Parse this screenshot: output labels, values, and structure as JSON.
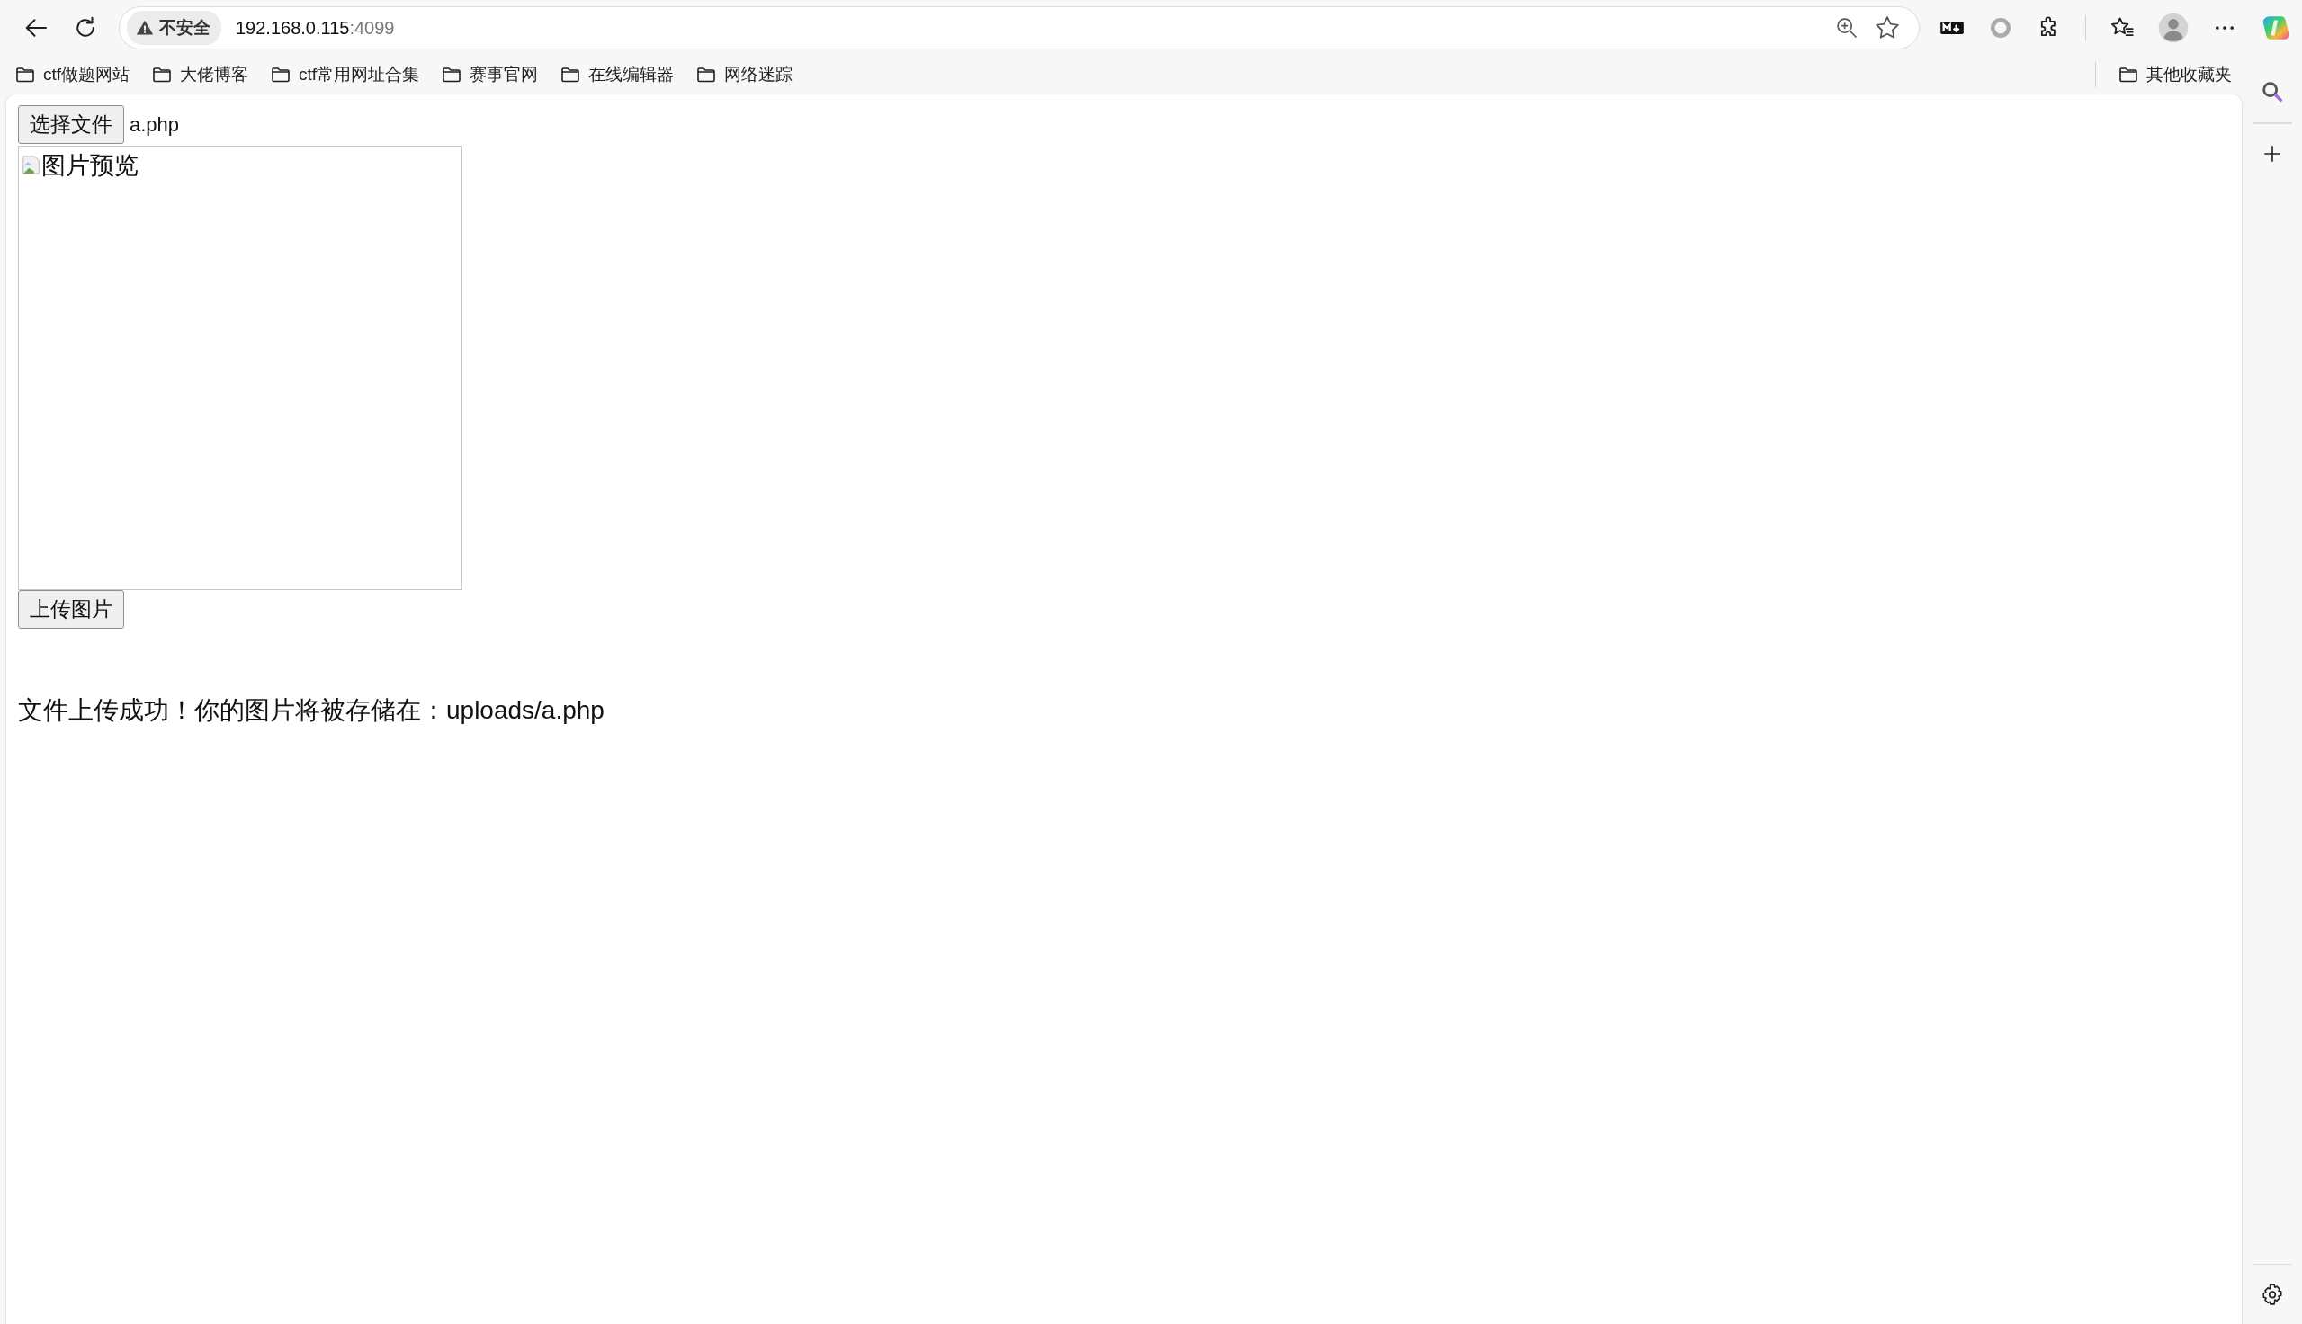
{
  "address_bar": {
    "security_label": "不安全",
    "host": "192.168.0.115",
    "port": ":4099"
  },
  "bookmarks": [
    {
      "label": "ctf做题网站"
    },
    {
      "label": "大佬博客"
    },
    {
      "label": "ctf常用网址合集"
    },
    {
      "label": "赛事官网"
    },
    {
      "label": "在线编辑器"
    },
    {
      "label": "网络迷踪"
    }
  ],
  "other_bookmarks": {
    "label": "其他收藏夹"
  },
  "page": {
    "file_button": "选择文件",
    "file_name": "a.php",
    "preview_alt": "图片预览",
    "upload_button": "上传图片",
    "message": "文件上传成功！你的图片将被存储在：uploads/a.php"
  }
}
